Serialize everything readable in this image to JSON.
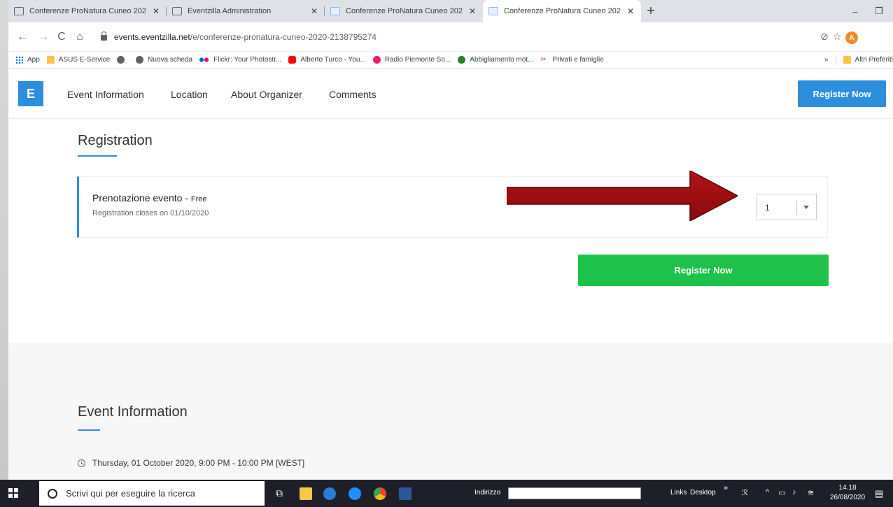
{
  "browser": {
    "tabs": [
      {
        "title": "Conferenze ProNatura Cuneo 202",
        "active": false
      },
      {
        "title": "Eventzilla Administration",
        "active": false
      },
      {
        "title": "Conferenze ProNatura Cuneo 202",
        "active": false
      },
      {
        "title": "Conferenze ProNatura Cuneo 202",
        "active": true
      }
    ],
    "url_host": "events.eventzilla.net",
    "url_path": "/e/conferenze-pronatura-cuneo-2020-2138795274",
    "profile_initial": "A",
    "bookmarks": [
      {
        "label": "App",
        "icon": "apps-grid-icon"
      },
      {
        "label": "ASUS E-Service",
        "icon": "folder-icon"
      },
      {
        "label": "",
        "icon": "globe-icon"
      },
      {
        "label": "Nuova scheda",
        "icon": "globe-icon"
      },
      {
        "label": "Flickr: Your Photostr...",
        "icon": "flickr-icon"
      },
      {
        "label": "Alberto Turco - You...",
        "icon": "youtube-icon"
      },
      {
        "label": "Radio Piemonte So...",
        "icon": "radio-icon"
      },
      {
        "label": "Abbigliamento mot...",
        "icon": "leaf-icon"
      },
      {
        "label": "Privati e famiglie",
        "icon": "scissors-icon"
      }
    ],
    "bookmarks_overflow": "»",
    "other_bookmarks": "Altri Preferiti"
  },
  "site": {
    "logo_letter": "E",
    "nav": [
      "Event Information",
      "Location",
      "About Organizer",
      "Comments"
    ],
    "top_register": "Register Now",
    "accent_color": "#2d8ede",
    "green_color": "#1ec24b"
  },
  "registration": {
    "title": "Registration",
    "ticket_name": "Prenotazione evento",
    "ticket_price": "Free",
    "ticket_separator": " - ",
    "closes_text": "Registration closes on 01/10/2020",
    "quantity": "1",
    "register_button": "Register Now"
  },
  "event_info": {
    "title": "Event Information",
    "datetime": "Thursday, 01 October 2020, 9:00 PM - 10:00 PM [WEST]"
  },
  "taskbar": {
    "search_placeholder": "Scrivi qui per eseguire la ricerca",
    "address_label": "Indirizzo",
    "links_label": "Links",
    "desktop_label": "Desktop",
    "time": "14.18",
    "date": "26/08/2020"
  }
}
